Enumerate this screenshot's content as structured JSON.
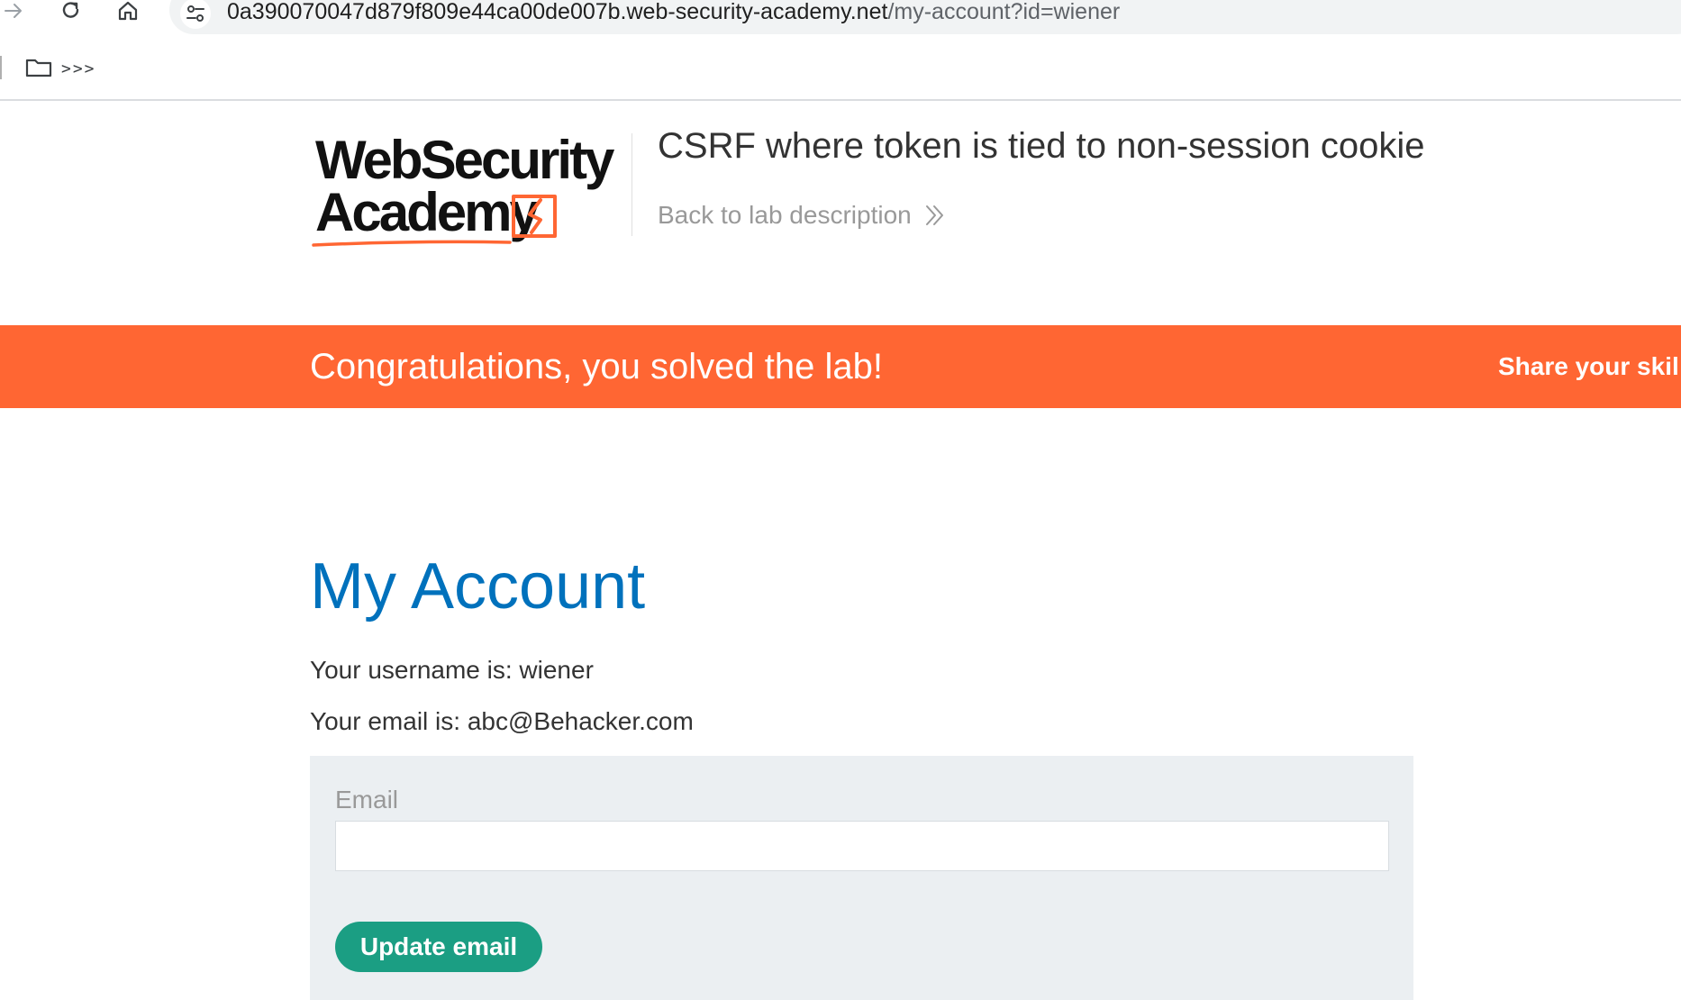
{
  "browser": {
    "url_host": "0a390070047d879f809e44ca00de007b.web-security-academy.net",
    "url_path": "/my-account?id=wiener",
    "bookmarks_folder_label": ">>>"
  },
  "header": {
    "logo_line1": "WebSecurity",
    "logo_line2": "Academy",
    "lab_title": "CSRF where token is tied to non-session cookie",
    "back_link_label": "Back to lab description",
    "back_link_icon": "double-chevron-right-icon"
  },
  "banner": {
    "message": "Congratulations, you solved the lab!",
    "share_label": "Share your skil",
    "color": "#ff6633"
  },
  "account": {
    "heading": "My Account",
    "username_line": "Your username is: wiener",
    "email_line": "Your email is: abc@Behacker.com"
  },
  "form": {
    "email_label": "Email",
    "email_value": "",
    "submit_label": "Update email",
    "button_color": "#1b9e83"
  },
  "colors": {
    "heading": "#0071bc",
    "accent": "#ff6633",
    "form_background": "#ebeff2"
  }
}
